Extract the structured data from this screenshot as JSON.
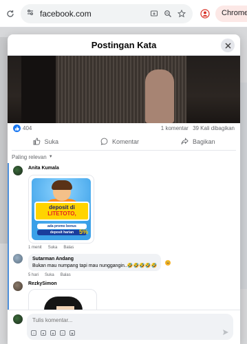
{
  "browser": {
    "url": "facebook.com",
    "badge": "Chrome ba"
  },
  "modal": {
    "title": "Postingan Kata",
    "stats": {
      "reactions": "404",
      "comments": "1 komentar",
      "shares": "39 Kali dibagikan"
    },
    "actions": {
      "like": "Suka",
      "comment": "Komentar",
      "share": "Bagikan"
    },
    "sort_label": "Paling relevan",
    "comments": [
      {
        "name": "Anita Kumala",
        "image": {
          "line1": "deposit di",
          "line2": "LITETOTO,",
          "line3": "ada promo bonus",
          "line4": "deposit harian",
          "percent": "5%"
        },
        "meta": {
          "time": "1 menit",
          "like": "Suka",
          "reply": "Balas"
        }
      },
      {
        "name": "Sutarman Andang",
        "text": "Bukan mau numpang tapi mau nunggangin..🤣🤣🤣🤣🤣",
        "meta": {
          "time": "5 hari",
          "like": "Suka",
          "reply": "Balas"
        }
      },
      {
        "name": "RezkySimon"
      }
    ],
    "composer": {
      "placeholder": "Tulis komentar..."
    }
  },
  "colors": {
    "accent": "#1877f2",
    "sort_border": "#4e8fd9"
  }
}
